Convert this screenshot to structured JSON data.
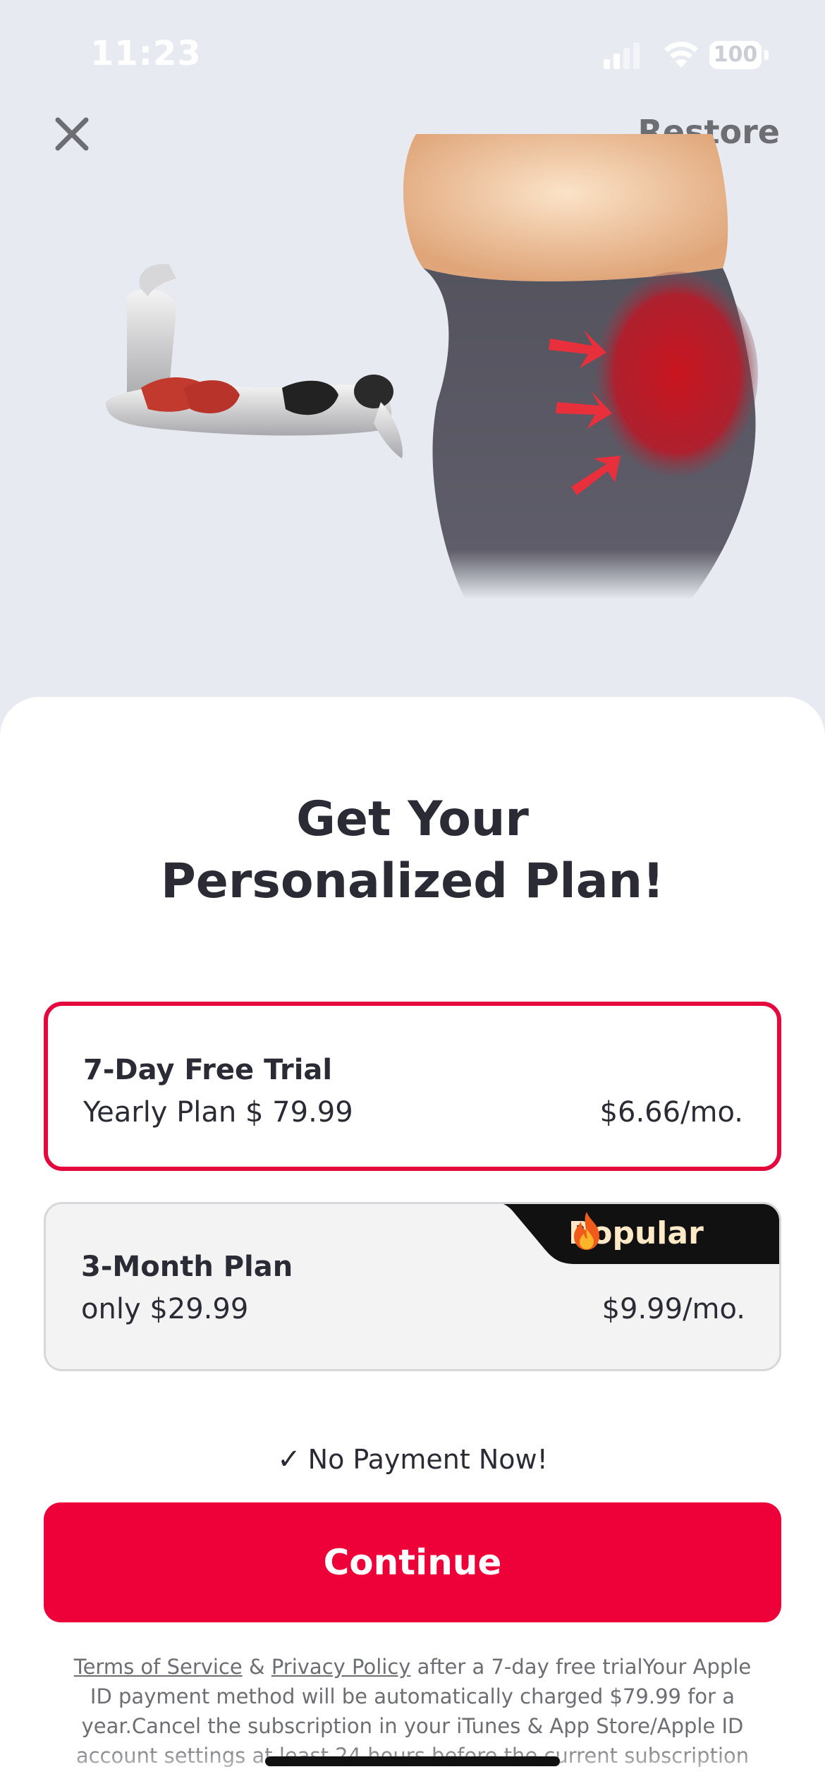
{
  "status_bar": {
    "time": "11:23",
    "battery": "100",
    "icons": [
      "signal-icon",
      "wifi-icon",
      "battery-icon"
    ]
  },
  "header": {
    "close_icon": "close-icon",
    "restore_label": "Restore"
  },
  "hero": {
    "illustration": "glute-exercise-illustration"
  },
  "headline": {
    "line1": "Get Your",
    "line2": "Personalized Plan!"
  },
  "plans": [
    {
      "title": "7-Day Free Trial",
      "subtitle": "Yearly Plan $ 79.99",
      "price": "$6.66/mo.",
      "selected": true
    },
    {
      "title": "3-Month Plan",
      "subtitle": "only $29.99",
      "price": "$9.99/mo.",
      "selected": false,
      "badge": "Popular",
      "badge_icon": "fire-icon"
    }
  ],
  "no_payment": {
    "check": "✓",
    "text": "No Payment Now!"
  },
  "continue_label": "Continue",
  "legal": {
    "terms": "Terms of Service",
    "and": " & ",
    "privacy": "Privacy Policy",
    "body": " after a 7-day free trialYour Apple ID payment method will be automatically charged $79.99 for a year.Cancel the subscription in your iTunes & App Store/Apple ID account settings at least 24 hours before the current subscription"
  },
  "colors": {
    "accent": "#ee0039",
    "selected_border": "#e5083d",
    "badge_bg": "#111111",
    "text": "#2b2b35",
    "muted": "#6d6e73"
  }
}
